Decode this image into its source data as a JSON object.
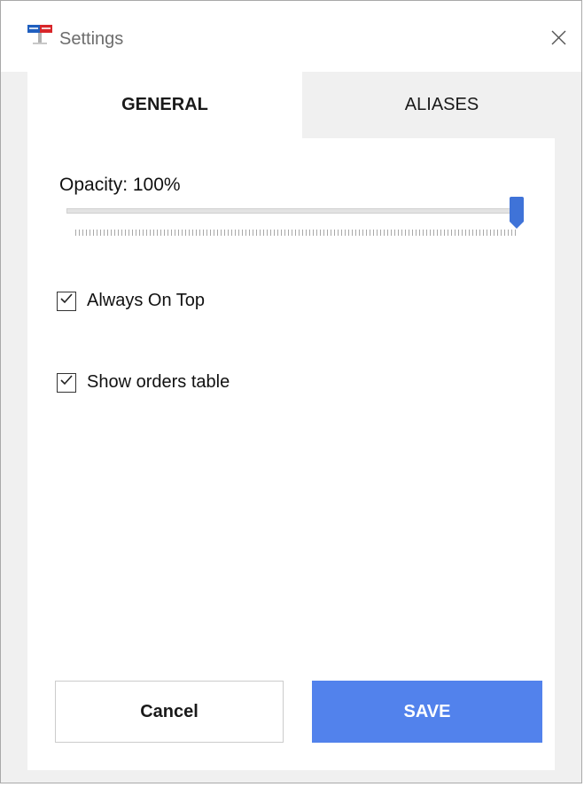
{
  "window": {
    "title": "Settings",
    "app_icon": "app-logo-icon",
    "close_icon": "close-icon"
  },
  "tabs": [
    {
      "label": "GENERAL",
      "active": true
    },
    {
      "label": "ALIASES",
      "active": false
    }
  ],
  "general": {
    "opacity_label": "Opacity: 100%",
    "opacity_value": 100,
    "opacity_min": 0,
    "opacity_max": 100,
    "always_on_top": {
      "label": "Always On Top",
      "checked": true
    },
    "show_orders_table": {
      "label": "Show orders table",
      "checked": true
    }
  },
  "buttons": {
    "cancel_label": "Cancel",
    "save_label": "SAVE"
  },
  "colors": {
    "accent": "#5282ec",
    "background": "#f0f0f0"
  }
}
